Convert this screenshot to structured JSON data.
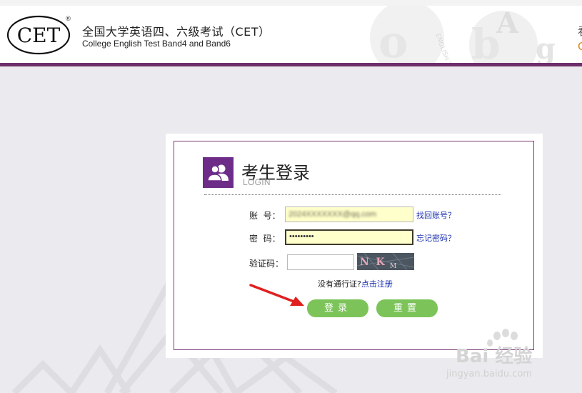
{
  "header": {
    "title_cn": "全国大学英语四、六级考试（CET）",
    "title_en": "College English Test Band4 and Band6",
    "logo_text": "CET",
    "logo_reg": "®",
    "right_glyph_top": "看",
    "right_glyph_bottom": "C"
  },
  "login": {
    "title": "考生登录",
    "subtitle": "LOGIN",
    "account_label": "账  号：",
    "account_value": "2024XXXXXXX@qq.com",
    "find_account_link": "找回账号？",
    "password_label": "密  码：",
    "password_value": "•••••••••",
    "forgot_password_link": "忘记密码？",
    "captcha_label": "验证码：",
    "captcha_value": "",
    "captcha_text": "N  K",
    "captcha_small": "M",
    "no_pass_text": "没有通行证?",
    "register_link": "点击注册",
    "login_button": "登录",
    "reset_button": "重置"
  },
  "watermark": {
    "brand": "Bai 经验",
    "url": "jingyan.baidu.com"
  },
  "colors": {
    "brand_purple": "#6e2e6b",
    "icon_purple": "#6d2c88",
    "button_green": "#7cc45a",
    "link_blue": "#1a2fb0",
    "input_yellow": "#ffffcc",
    "arrow_red": "#e02020"
  }
}
